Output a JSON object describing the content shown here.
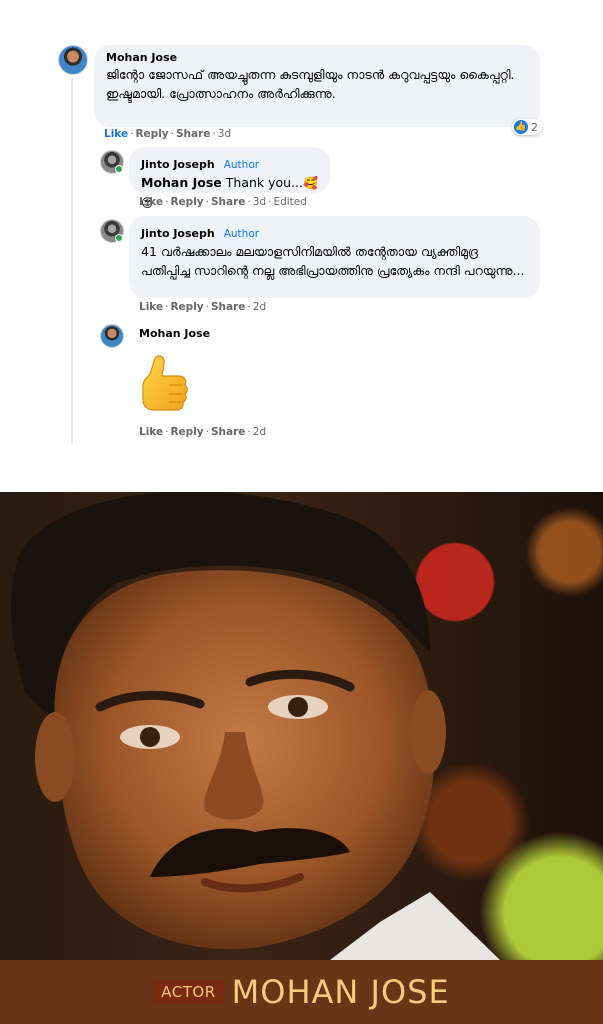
{
  "comments": [
    {
      "name": "Mohan Jose",
      "text": "ജിന്റോ ജോസഫ് അയച്ചുതന്ന കുടമ്പുളിയും നാടൻ കറുവപ്പട്ടയും കൈപ്പറ്റി. ഇഷ്ടമായി. പ്രോത്സാഹനം അർഹിക്കുന്നു.",
      "actions": {
        "like": "Like",
        "reply": "Reply",
        "share": "Share",
        "time": "3d"
      },
      "reaction_count": "2"
    },
    {
      "name": "Jinto Joseph",
      "badge": "Author",
      "mention": "Mohan Jose",
      "text": " Thank you...",
      "emojis": "🥰😍",
      "actions": {
        "like": "Like",
        "reply": "Reply",
        "share": "Share",
        "time": "3d",
        "edited": "Edited"
      }
    },
    {
      "name": "Jinto Joseph",
      "badge": "Author",
      "text": "41 വർഷക്കാലം മലയാളസിനിമയിൽ തന്റേതായ വ്യക്തിമുദ്ര പതിപ്പിച്ച സാറിന്റെ നല്ല അഭിപ്രായത്തിനു പ്രത്യേകം നന്ദി പറയുന്നു...",
      "actions": {
        "like": "Like",
        "reply": "Reply",
        "share": "Share",
        "time": "2d"
      }
    },
    {
      "name": "Mohan Jose",
      "sticker": "thumbs-up",
      "actions": {
        "like": "Like",
        "reply": "Reply",
        "share": "Share",
        "time": "2d"
      }
    }
  ],
  "banner": {
    "tag": "ACTOR",
    "name": "MOHAN JOSE"
  },
  "colors": {
    "bubble": "#f0f2f5",
    "link_blue": "#1b74e4",
    "banner_bg": "#6a3416",
    "banner_text": "#f3cd7d"
  }
}
